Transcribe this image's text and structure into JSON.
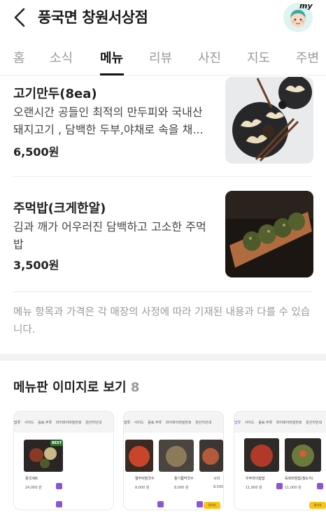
{
  "header": {
    "title": "풍국면 창원서상점",
    "avatar_tag": "my"
  },
  "tabs": [
    {
      "label": "홈"
    },
    {
      "label": "소식"
    },
    {
      "label": "메뉴"
    },
    {
      "label": "리뷰"
    },
    {
      "label": "사진"
    },
    {
      "label": "지도"
    },
    {
      "label": "주변"
    }
  ],
  "active_tab": "메뉴",
  "menu_items": [
    {
      "name": "고기만두(8ea)",
      "description": "오랜시간 공들인 최적의 만두피와 국내산 돼지고기 , 담백한 두부,야채로 속을 채...",
      "price": "6,500원"
    },
    {
      "name": "주먹밥(크게한알)",
      "description": "김과 깨가 어우러진 담백하고 고소한 주먹밥",
      "price": "3,500원"
    }
  ],
  "notice": "메뉴 항목과 가격은 각 매장의 사정에 따라 기재된 내용과 다를 수 있습니다.",
  "gallery": {
    "title": "메뉴판 이미지로 보기",
    "count": "8",
    "cards": [
      {
        "nav": [
          "밥류",
          "사이드",
          "음료,주류",
          "와이파이비밀번호",
          "원산지안내"
        ],
        "badge": "BEST",
        "items": [
          {
            "label": "풍국세트",
            "price": "24,000 원"
          }
        ]
      },
      {
        "nav": [
          "밥류",
          "사이드",
          "음료,주류",
          "와이파이비밀번호",
          "원산지안내"
        ],
        "items": [
          {
            "label": "열무비빔국수",
            "price": "8,000 원"
          },
          {
            "label": "들기름막국수",
            "price": "8,000 원"
          },
          {
            "label": "시더",
            "price": "8,500"
          }
        ]
      },
      {
        "nav": [
          "밥류",
          "사이드",
          "음료,주류",
          "와이파이비밀번호",
          "원산지안내"
        ],
        "items": [
          {
            "label": "우주라이찹밥",
            "price": "11,000 원"
          },
          {
            "label": "육회비빔밥(청도식)",
            "price": "11,000 원"
          }
        ]
      }
    ],
    "sticker_text": "맛서사"
  }
}
